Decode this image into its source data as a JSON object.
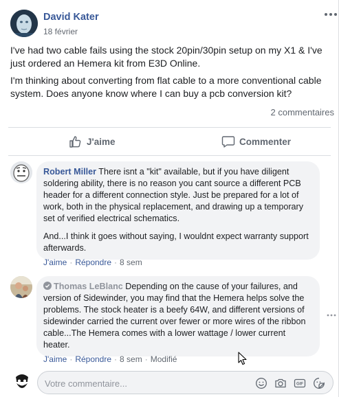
{
  "post": {
    "author": "David Kater",
    "date": "18 février",
    "paragraphs": [
      "I've had two cable fails using the stock 20pin/30pin setup on my X1 & I've just ordered an Hemera kit from E3D Online.",
      "I'm thinking about converting from flat cable to a more conventional cable system. Does anyone know where I can buy a pcb conversion kit?"
    ],
    "comments_count": "2 commentaires"
  },
  "actions": {
    "like": "J'aime",
    "comment": "Commenter"
  },
  "comments": [
    {
      "name": "Robert Miller",
      "text1": "There isnt a \"kit\" available, but if you have diligent soldering ability, there is no reason you cant source a different PCB header for a different connection style. Just be prepared for a lot of work, both in the physical replacement, and drawing up a temporary set of verified electrical schematics.",
      "text2": "And...I think it goes without saying, I wouldnt expect warranty support afterwards.",
      "like": "J'aime",
      "reply": "Répondre",
      "time": "8 sem"
    },
    {
      "name": "Thomas LeBlanc",
      "text1": "Depending on the cause of your failures, and version of Sidewinder, you may find that the Hemera helps solve the problems. The stock heater is a beefy 64W, and different versions of sidewinder carried the current over fewer or more wires of the ribbon cable...The Hemera comes with a lower wattage / lower current heater.",
      "like": "J'aime",
      "reply": "Répondre",
      "time": "8 sem",
      "edited": "Modifié"
    }
  ],
  "composer": {
    "placeholder": "Votre commentaire..."
  },
  "icons": {
    "more": "ellipsis-icon",
    "like": "thumbs-up-icon",
    "comment": "speech-bubble-icon",
    "emoji": "smiley-icon",
    "camera": "camera-icon",
    "gif": "gif-icon",
    "sticker": "sticker-icon",
    "pending": "pending-check-icon"
  },
  "colors": {
    "link": "#385898",
    "secondary_text": "#606770",
    "bubble_bg": "#f2f3f5"
  }
}
